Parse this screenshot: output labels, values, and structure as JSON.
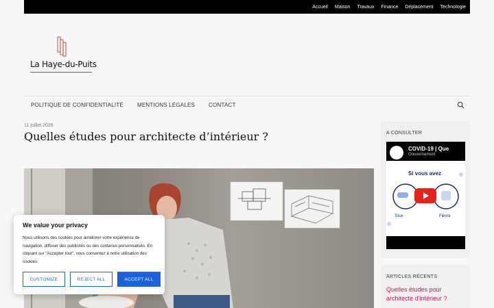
{
  "topnav": {
    "items": [
      "Accueil",
      "Maison",
      "Travaux",
      "Finance",
      "Déplacement",
      "Technologie"
    ]
  },
  "site": {
    "name": "La Haye-du-Puits",
    "accent_color": "#c0392b"
  },
  "mainnav": {
    "items": [
      "POLITIQUE DE CONFIDENTIALITÉ",
      "MENTIONS LÉGALES",
      "CONTACT"
    ],
    "search_icon": "search-icon"
  },
  "article": {
    "date": "11 juillet 2026",
    "title": "Quelles études pour architecte d’intérieur ?"
  },
  "sidebar": {
    "consult_title": "A CONSULTER",
    "video": {
      "title": "COVID-19 | Que",
      "subtitle": "Gouvernement",
      "banner": "Si vous avez",
      "label_left": "Toux",
      "label_right": "Fièvre"
    },
    "recent_title": "ARTICLES RÉCENTS",
    "recent_link": "Quelles études pour architecte d’intérieur ?",
    "link_color": "#c2185b"
  },
  "cookie": {
    "title": "We value your privacy",
    "text": "Nous utilisons des cookies pour améliorer votre expérience de navigation, diffuser des publicités ou des contenus personnalisés. En cliquant sur \"Accepter tout\", vous consentez à notre utilisation des cookies.",
    "customize": "CUSTOMIZE",
    "reject": "REJECT ALL",
    "accept": "ACCEPT ALL",
    "button_color": "#1863dc"
  }
}
